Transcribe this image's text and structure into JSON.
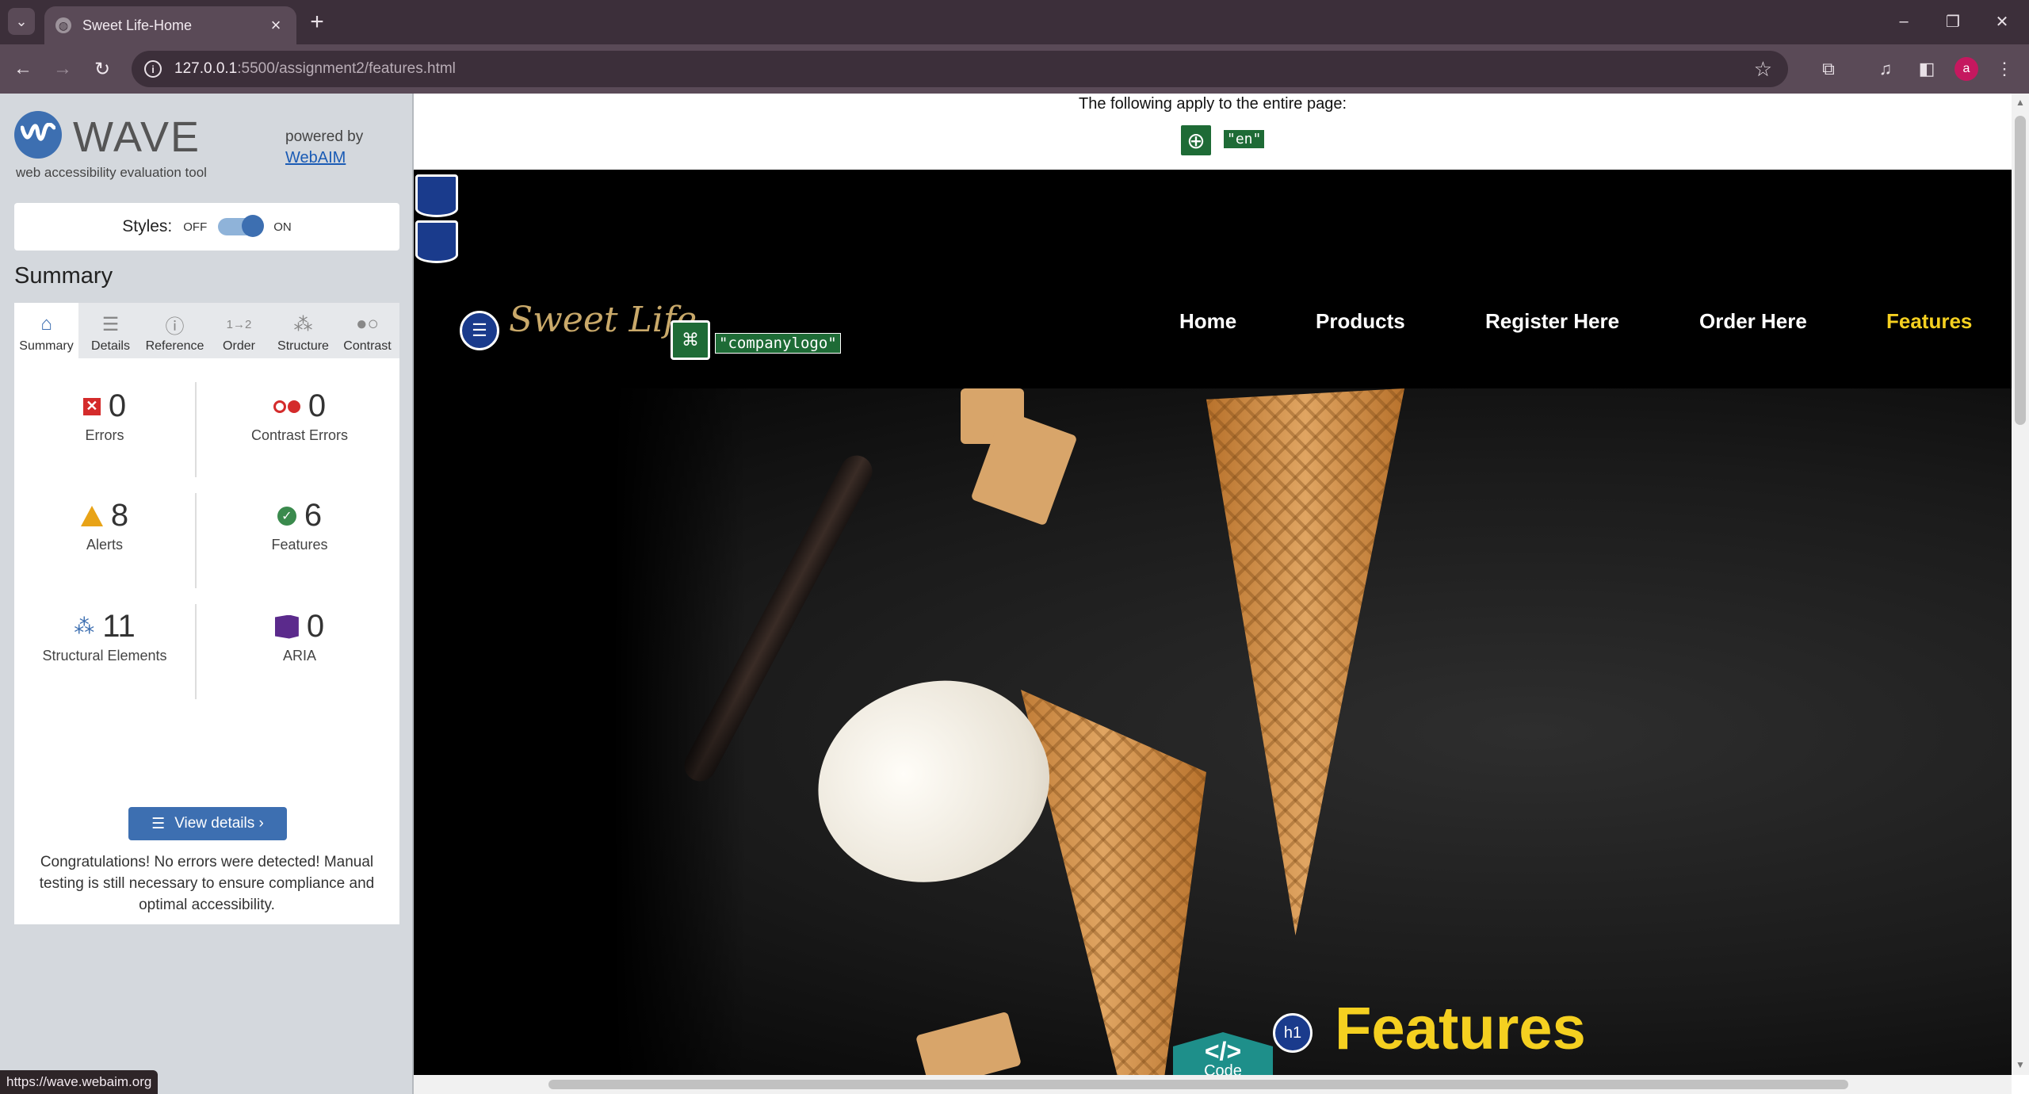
{
  "browser": {
    "tab_title": "Sweet Life-Home",
    "url_host": "127.0.0.1",
    "url_path": ":5500/assignment2/features.html",
    "avatar_letter": "a",
    "status_url": "https://wave.webaim.org"
  },
  "wave": {
    "logo_text": "WAVE",
    "tagline": "web accessibility evaluation tool",
    "powered_by": "powered by",
    "webaim_link": "WebAIM",
    "styles_label": "Styles:",
    "styles_off": "OFF",
    "styles_on": "ON",
    "summary_heading": "Summary",
    "tabs": [
      {
        "label": "Summary",
        "icon": "home-icon"
      },
      {
        "label": "Details",
        "icon": "list-icon"
      },
      {
        "label": "Reference",
        "icon": "info-icon"
      },
      {
        "label": "Order",
        "icon": "order-icon"
      },
      {
        "label": "Structure",
        "icon": "structure-icon"
      },
      {
        "label": "Contrast",
        "icon": "contrast-icon"
      }
    ],
    "stats": {
      "errors": {
        "value": "0",
        "label": "Errors"
      },
      "contrast_errors": {
        "value": "0",
        "label": "Contrast Errors"
      },
      "alerts": {
        "value": "8",
        "label": "Alerts"
      },
      "features": {
        "value": "6",
        "label": "Features"
      },
      "structural": {
        "value": "11",
        "label": "Structural Elements"
      },
      "aria": {
        "value": "0",
        "label": "ARIA"
      }
    },
    "view_details": "View details ›",
    "congrats": "Congratulations! No errors were detected! Manual testing is still necessary to ensure compliance and optimal accessibility."
  },
  "page": {
    "banner_text": "The following apply to the entire page:",
    "lang_tag": "\"en\"",
    "logo_text": "Sweet Life",
    "logo_alt": "\"companylogo\"",
    "nav": [
      "Home",
      "Products",
      "Register Here",
      "Order Here",
      "Features"
    ],
    "active_nav": "Features",
    "code_label": "Code",
    "code_glyph": "</>",
    "h1_badge": "h1",
    "hero_title": "Features"
  },
  "colors": {
    "accent_yellow": "#f5d020",
    "wave_blue": "#3d6fb1",
    "feature_green": "#1e6b36",
    "error_red": "#d42b2b"
  }
}
